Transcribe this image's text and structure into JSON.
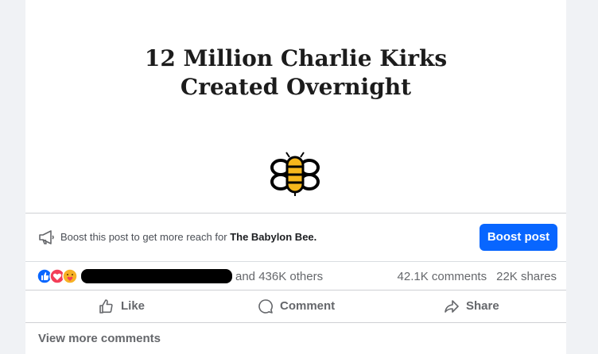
{
  "post": {
    "headline_line1": "12 Million Charlie Kirks",
    "headline_line2": "Created Overnight",
    "logo_icon": "babylon-bee-logo"
  },
  "boost": {
    "text_prefix": "Boost this post to get more reach for",
    "page_name": "The Babylon Bee.",
    "button_label": "Boost post",
    "icon": "megaphone-icon"
  },
  "stats": {
    "reaction_icons": [
      "like-reaction-icon",
      "love-reaction-icon",
      "care-reaction-icon"
    ],
    "names_tail": "and 436K others",
    "comments": "42.1K comments",
    "shares": "22K shares"
  },
  "actions": {
    "like_label": "Like",
    "comment_label": "Comment",
    "share_label": "Share"
  },
  "footer": {
    "view_more_comments": "View more comments"
  },
  "colors": {
    "accent": "#0866ff",
    "secondary_text": "#65676b",
    "page_bg": "#f0f2f5",
    "logo_yellow": "#f6b71c"
  }
}
